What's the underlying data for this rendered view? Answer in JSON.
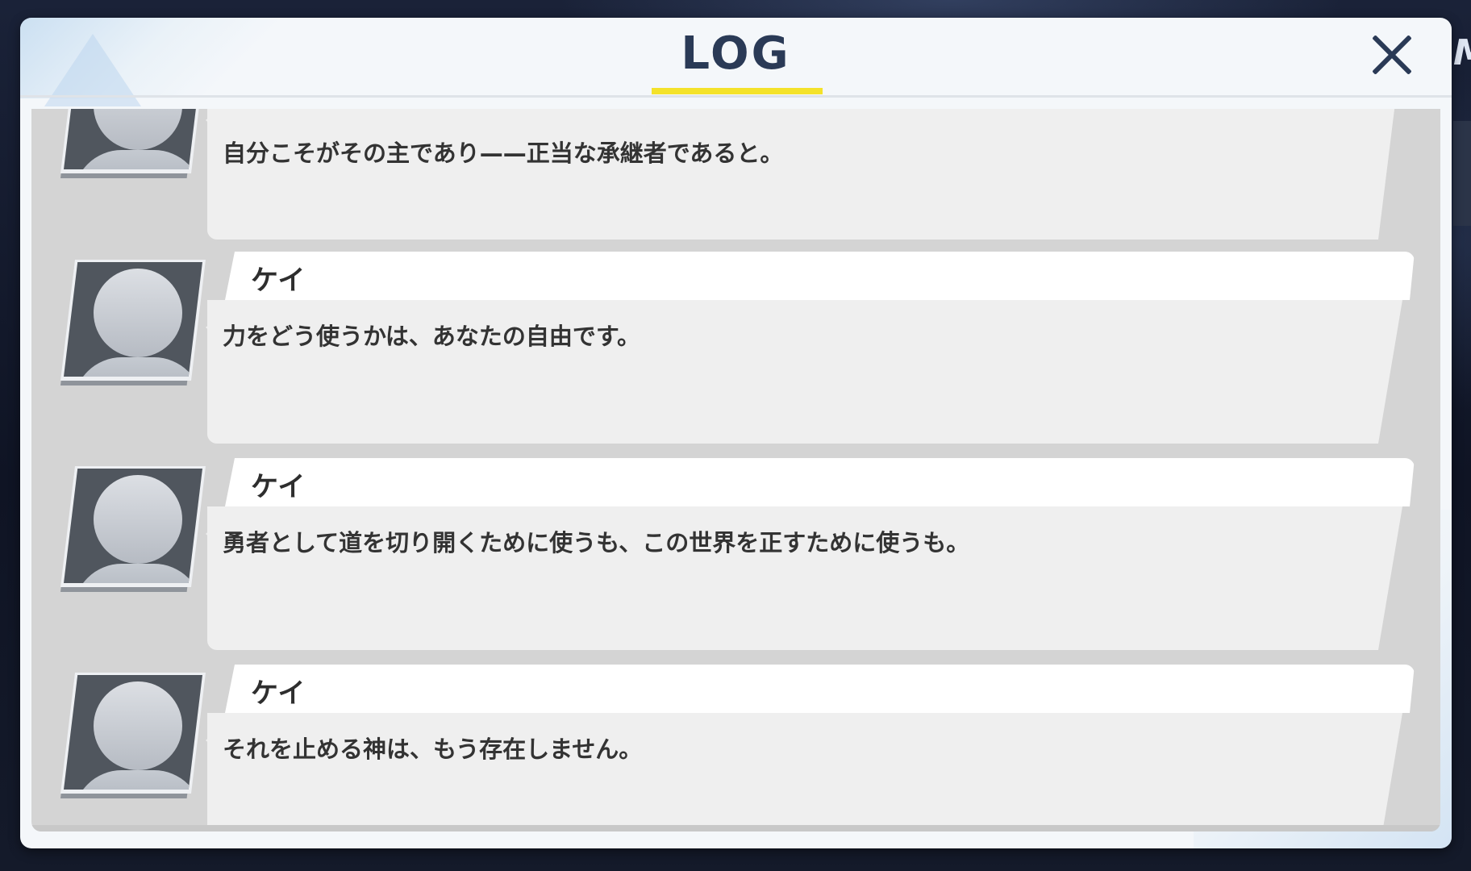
{
  "header": {
    "title": "LOG",
    "close_icon": "close-icon",
    "accent_color": "#f4e22a",
    "title_color": "#2a3a56"
  },
  "log": {
    "entries": [
      {
        "speaker": "",
        "text": "自分こそがその主であり——正当な承継者であると。",
        "avatar_icon": "default-avatar-icon"
      },
      {
        "speaker": "ケイ",
        "text": "力をどう使うかは、あなたの自由です。",
        "avatar_icon": "default-avatar-icon"
      },
      {
        "speaker": "ケイ",
        "text": "勇者として道を切り開くために使うも、この世界を正すために使うも。",
        "avatar_icon": "default-avatar-icon"
      },
      {
        "speaker": "ケイ",
        "text": "それを止める神は、もう存在しません。",
        "avatar_icon": "default-avatar-icon"
      }
    ]
  }
}
